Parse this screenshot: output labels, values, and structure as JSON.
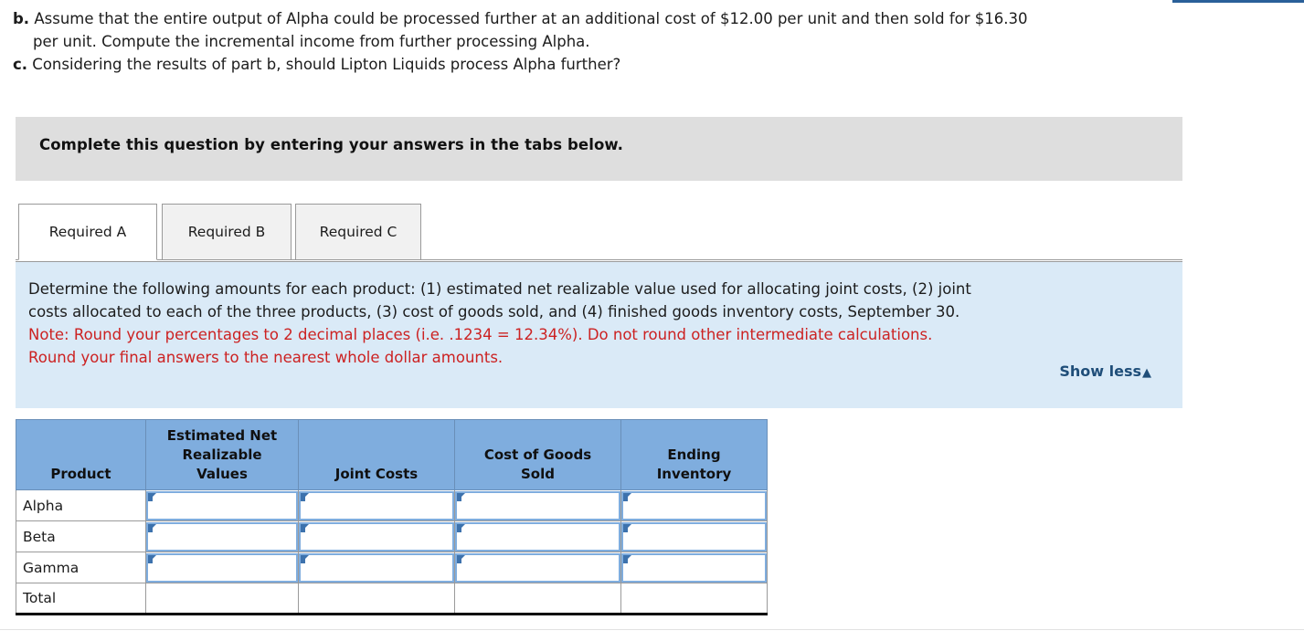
{
  "question": {
    "part_b_marker": "b.",
    "part_b_line1": " Assume that the entire output of Alpha could be processed further at an additional cost of $12.00 per unit and then sold for $16.30",
    "part_b_line2": "per unit. Compute the incremental income from further processing Alpha.",
    "part_c_marker": "c.",
    "part_c_line1": " Considering the results of part b, should Lipton Liquids process Alpha further?"
  },
  "banner": {
    "text": "Complete this question by entering your answers in the tabs below."
  },
  "tabs": [
    {
      "label": "Required A",
      "active": true
    },
    {
      "label": "Required B",
      "active": false
    },
    {
      "label": "Required C",
      "active": false
    }
  ],
  "instruction": {
    "line1": "Determine the following amounts for each product: (1) estimated net realizable value used for allocating joint costs, (2) joint",
    "line2": "costs allocated to each of the three products, (3) cost of goods sold, and (4) finished goods inventory costs, September 30.",
    "note_line1": "Note: Round your percentages to 2 decimal places (i.e. .1234 = 12.34%). Do not round other intermediate calculations.",
    "note_line2": "Round your final answers to the nearest whole dollar amounts.",
    "show_less_label": "Show less",
    "show_less_caret": "▲",
    "note_color": "#cc2222",
    "panel_color": "#daeaf7",
    "link_color": "#1f4e79"
  },
  "table": {
    "headers": {
      "product": "Product",
      "enrv": "Estimated Net\nRealizable\nValues",
      "enrv_l1": "Estimated Net",
      "enrv_l2": "Realizable",
      "enrv_l3": "Values",
      "joint_costs": "Joint Costs",
      "cogs_l1": "Cost of Goods",
      "cogs_l2": "Sold",
      "ending_l1": "Ending",
      "ending_l2": "Inventory"
    },
    "header_bg": "#7fadde",
    "input_border": "#7fadde",
    "rows": [
      {
        "label": "Alpha",
        "enrv": "",
        "joint_costs": "",
        "cogs": "",
        "ending": "",
        "editable": true
      },
      {
        "label": "Beta",
        "enrv": "",
        "joint_costs": "",
        "cogs": "",
        "ending": "",
        "editable": true
      },
      {
        "label": "Gamma",
        "enrv": "",
        "joint_costs": "",
        "cogs": "",
        "ending": "",
        "editable": true
      },
      {
        "label": "Total",
        "enrv": "",
        "joint_costs": "",
        "cogs": "",
        "ending": "",
        "editable": false
      }
    ]
  }
}
